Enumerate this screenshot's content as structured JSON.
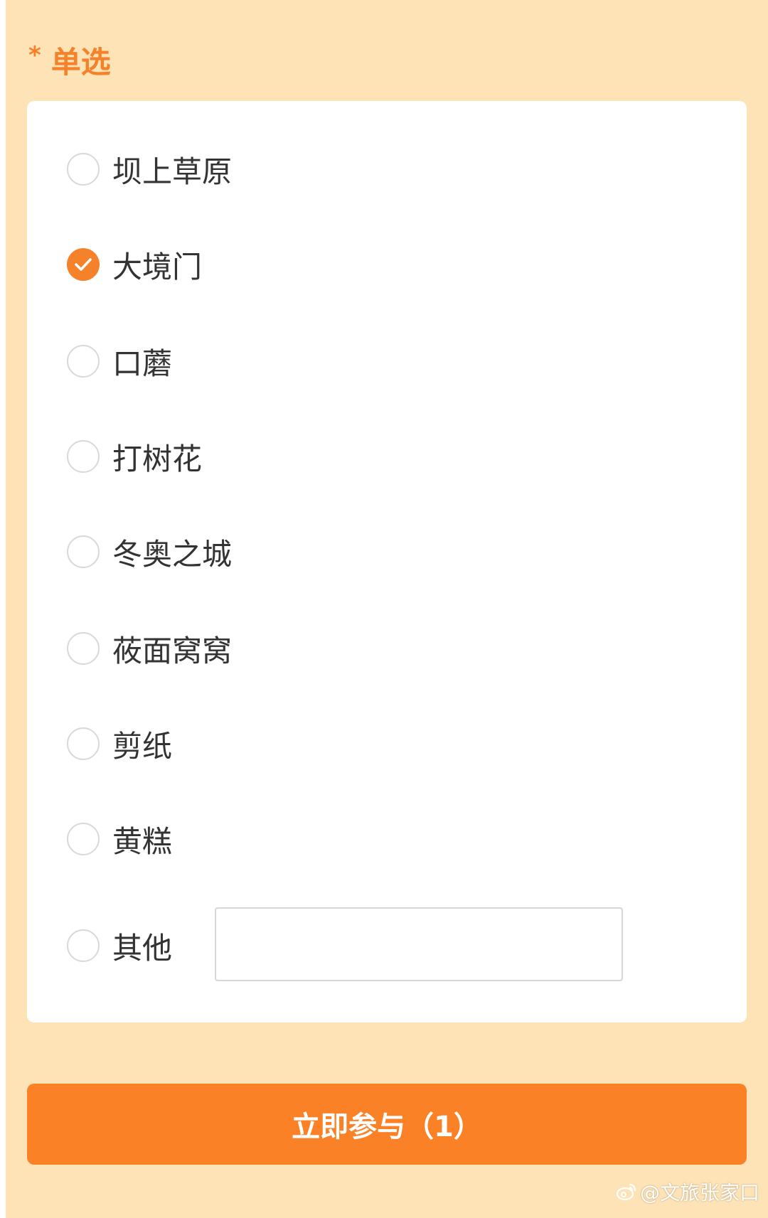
{
  "question": {
    "required_mark": "*",
    "title": "单选"
  },
  "options": [
    {
      "label": "坝上草原",
      "checked": false
    },
    {
      "label": "大境门",
      "checked": true
    },
    {
      "label": "口蘑",
      "checked": false
    },
    {
      "label": "打树花",
      "checked": false
    },
    {
      "label": "冬奥之城",
      "checked": false
    },
    {
      "label": "莜面窝窝",
      "checked": false
    },
    {
      "label": "剪纸",
      "checked": false
    },
    {
      "label": "黄糕",
      "checked": false
    },
    {
      "label": "其他",
      "checked": false
    }
  ],
  "other_input": {
    "value": "",
    "placeholder": ""
  },
  "submit": {
    "label": "立即参与（1）"
  },
  "watermark": {
    "text": "@文旅张家口",
    "icon": "weibo-icon"
  },
  "colors": {
    "accent": "#f5812a",
    "button": "#fb8126",
    "background": "#fde3b5",
    "card": "#ffffff",
    "text": "#333333",
    "radio_border": "#d9d9d9"
  }
}
